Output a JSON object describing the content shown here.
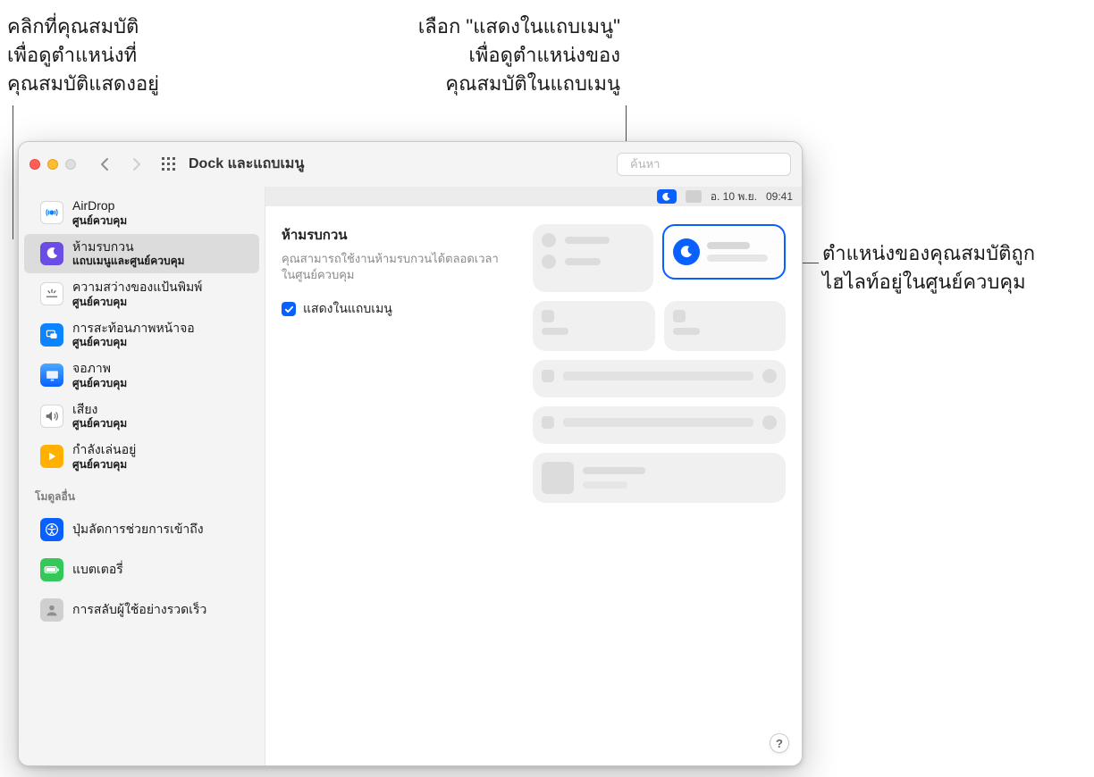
{
  "annotations": {
    "left": "คลิกที่คุณสมบัติ\nเพื่อดูตำแหน่งที่\nคุณสมบัติแสดงอยู่",
    "top_right": "เลือก \"แสดงในแถบเมนู\"\nเพื่อดูตำแหน่งของ\nคุณสมบัติในแถบเมนู",
    "right": "ตำแหน่งของคุณสมบัติถูก\nไฮไลท์อยู่ในศูนย์ควบคุม"
  },
  "window": {
    "title": "Dock และแถบเมนู",
    "search_placeholder": "ค้นหา"
  },
  "sidebar": {
    "items": [
      {
        "title": "AirDrop",
        "sub": "ศูนย์ควบคุม",
        "icon": "airdrop"
      },
      {
        "title": "ห้ามรบกวน",
        "sub": "แถบเมนูและศูนย์ควบคุม",
        "icon": "dnd",
        "selected": true
      },
      {
        "title": "ความสว่างของแป้นพิมพ์",
        "sub": "ศูนย์ควบคุม",
        "icon": "kb"
      },
      {
        "title": "การสะท้อนภาพหน้าจอ",
        "sub": "ศูนย์ควบคุม",
        "icon": "mirror"
      },
      {
        "title": "จอภาพ",
        "sub": "ศูนย์ควบคุม",
        "icon": "display"
      },
      {
        "title": "เสียง",
        "sub": "ศูนย์ควบคุม",
        "icon": "sound"
      },
      {
        "title": "กำลังเล่นอยู่",
        "sub": "ศูนย์ควบคุม",
        "icon": "play"
      }
    ],
    "section_label": "โมดูลอื่น",
    "other_items": [
      {
        "title": "ปุ่มลัดการช่วยการเข้าถึง",
        "icon": "access"
      },
      {
        "title": "แบตเตอรี่",
        "icon": "battery"
      },
      {
        "title": "การสลับผู้ใช้อย่างรวดเร็ว",
        "icon": "user"
      }
    ]
  },
  "content": {
    "menu_bar": {
      "date": "อ. 10 พ.ย.",
      "time": "09:41"
    },
    "title": "ห้ามรบกวน",
    "description": "คุณสามารถใช้งานห้ามรบกวนได้ตลอดเวลาในศูนย์ควบคุม",
    "checkbox_label": "แสดงในแถบเมนู",
    "help": "?"
  }
}
